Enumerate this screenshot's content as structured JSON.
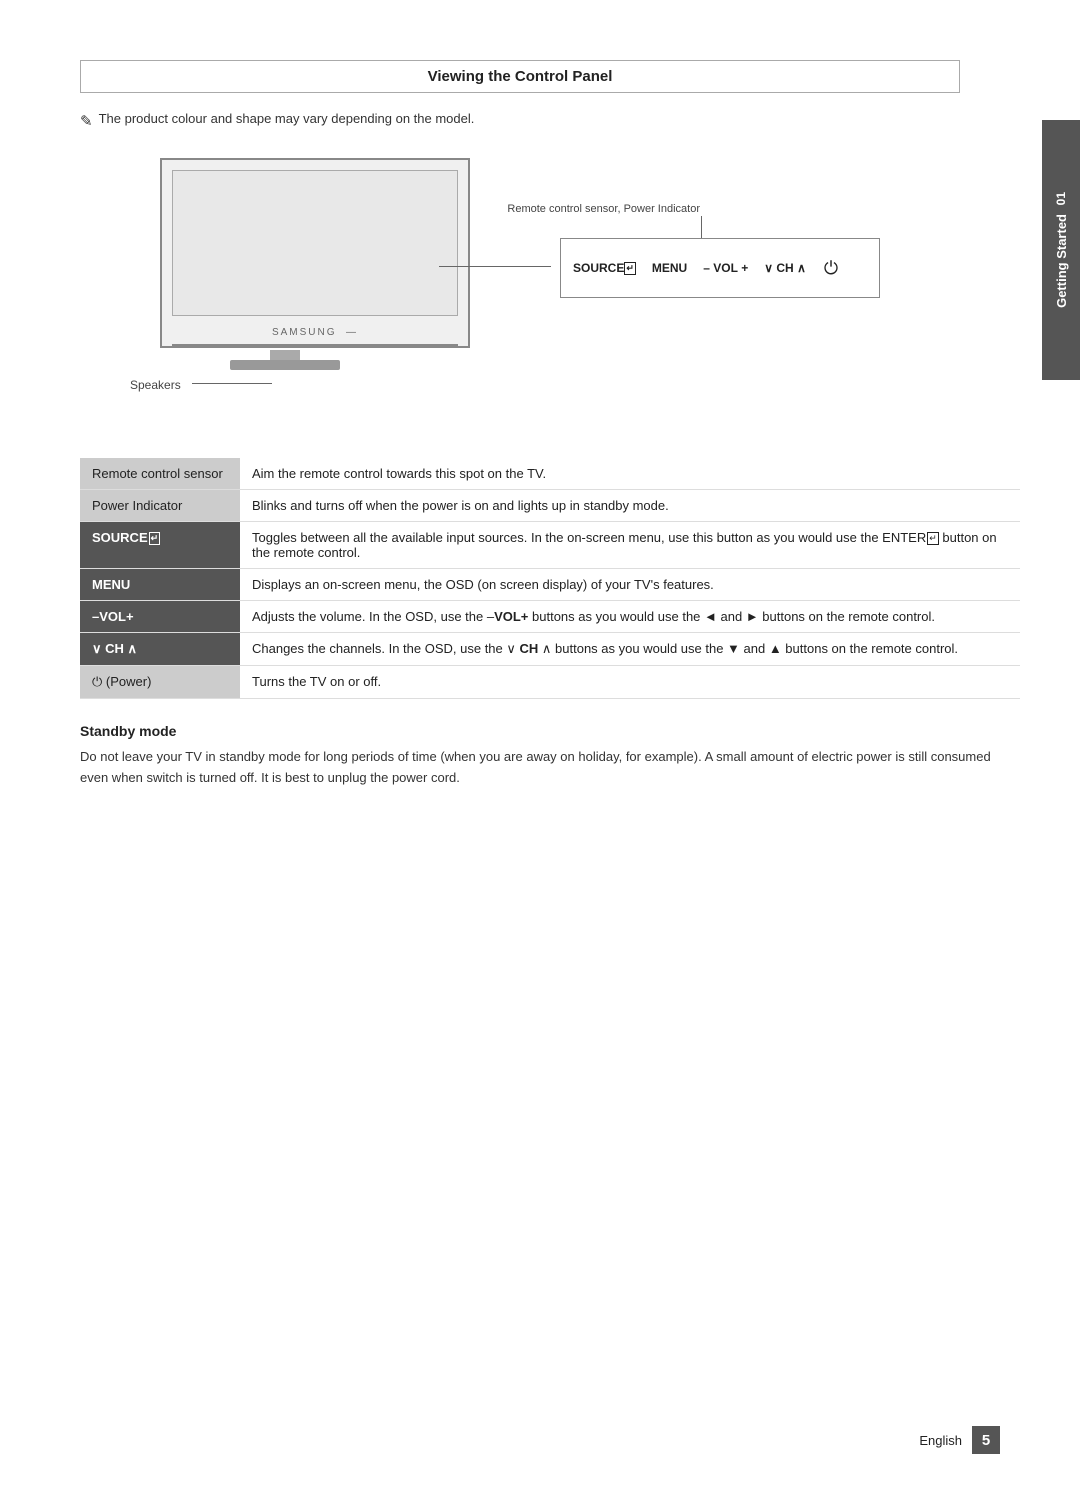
{
  "page": {
    "title": "Viewing the Control Panel",
    "note": "The product colour and shape may vary depending on the model.",
    "note_symbol": "✎",
    "sidebar": {
      "number": "01",
      "label": "Getting Started"
    },
    "diagram": {
      "brand_label": "SAMSUNG",
      "speakers_label": "Speakers",
      "callout_label": "Remote control sensor, Power Indicator",
      "buttons_display": "SOURCE⏎  MENU  – VOL +  ∨ CH ∧  ⏻"
    },
    "table": {
      "rows": [
        {
          "label": "Remote control sensor",
          "description": "Aim the remote control towards this spot on the TV.",
          "style": "light"
        },
        {
          "label": "Power Indicator",
          "description": "Blinks and turns off when the power is on and lights up in standby mode.",
          "style": "light"
        },
        {
          "label": "SOURCE⏎",
          "description": "Toggles between all the available input sources. In the on-screen menu, use this button as you would use the ENTER⏎ button on the remote control.",
          "style": "dark"
        },
        {
          "label": "MENU",
          "description": "Displays an on-screen menu, the OSD (on screen display) of your TV's features.",
          "style": "dark"
        },
        {
          "label": "−VOL+",
          "description": "Adjusts the volume. In the OSD, use the −VOL+ buttons as you would use the ◄ and ► buttons on the remote control.",
          "style": "dark"
        },
        {
          "label": "∨ CH ∧",
          "description": "Changes the channels. In the OSD, use the ∨ CH ∧ buttons as you would use the ▼ and ▲ buttons on the remote control.",
          "style": "dark"
        },
        {
          "label": "⏻ (Power)",
          "description": "Turns the TV on or off.",
          "style": "light"
        }
      ]
    },
    "standby": {
      "title": "Standby mode",
      "text": "Do not leave your TV in standby mode for long periods of time (when you are away on holiday, for example). A small amount of electric power is still consumed even when switch is turned off. It is best to unplug the power cord."
    },
    "footer": {
      "language": "English",
      "page_number": "5"
    }
  }
}
